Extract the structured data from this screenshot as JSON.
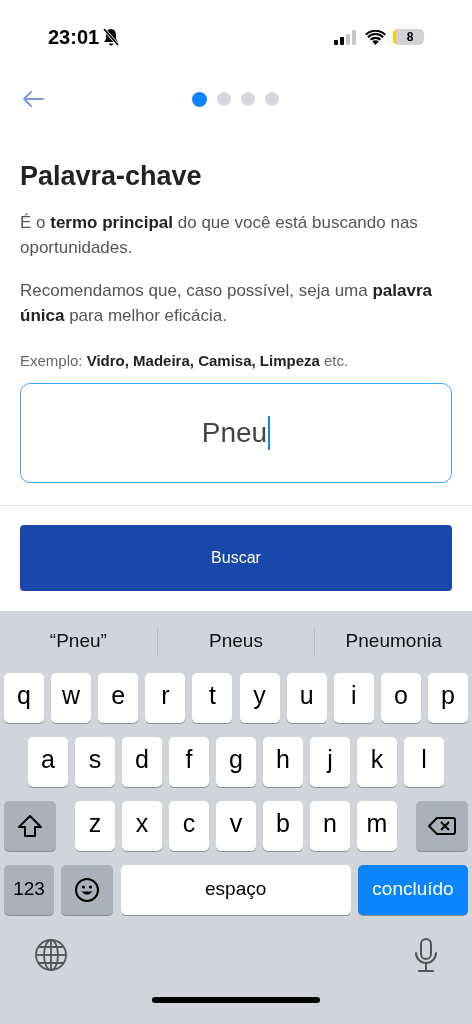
{
  "status_bar": {
    "time": "23:01",
    "silent": true,
    "battery": "8"
  },
  "steps": [
    {
      "selected": true
    },
    {
      "selected": false
    },
    {
      "selected": false
    },
    {
      "selected": false
    }
  ],
  "title": "Palavra-chave",
  "paragraphs": [
    "É o **termo principal** do que você está buscando nas oportunidades.",
    "Recomendamos que, caso possível, seja uma **palavra única** para melhor eficácia."
  ],
  "example": "Exemplo: **Vidro, Madeira, Camisa, Limpeza** etc.",
  "keyword_field": {
    "value": "Pneu",
    "focused": true
  },
  "search_button": "Buscar",
  "keyboard": {
    "suggestions": [
      "“Pneu”",
      "Pneus",
      "Pneumonia"
    ],
    "letter_rows": [
      [
        "q",
        "w",
        "e",
        "r",
        "t",
        "y",
        "u",
        "i",
        "o",
        "p"
      ],
      [
        "a",
        "s",
        "d",
        "f",
        "g",
        "h",
        "j",
        "k",
        "l"
      ],
      [
        "z",
        "x",
        "c",
        "v",
        "b",
        "n",
        "m"
      ]
    ],
    "bottom_row": [
      {
        "kind": "numbers",
        "label": "123"
      },
      {
        "kind": "emoji"
      },
      {
        "kind": "space",
        "label": "espaço"
      },
      {
        "kind": "done",
        "label": "concluído"
      }
    ]
  }
}
